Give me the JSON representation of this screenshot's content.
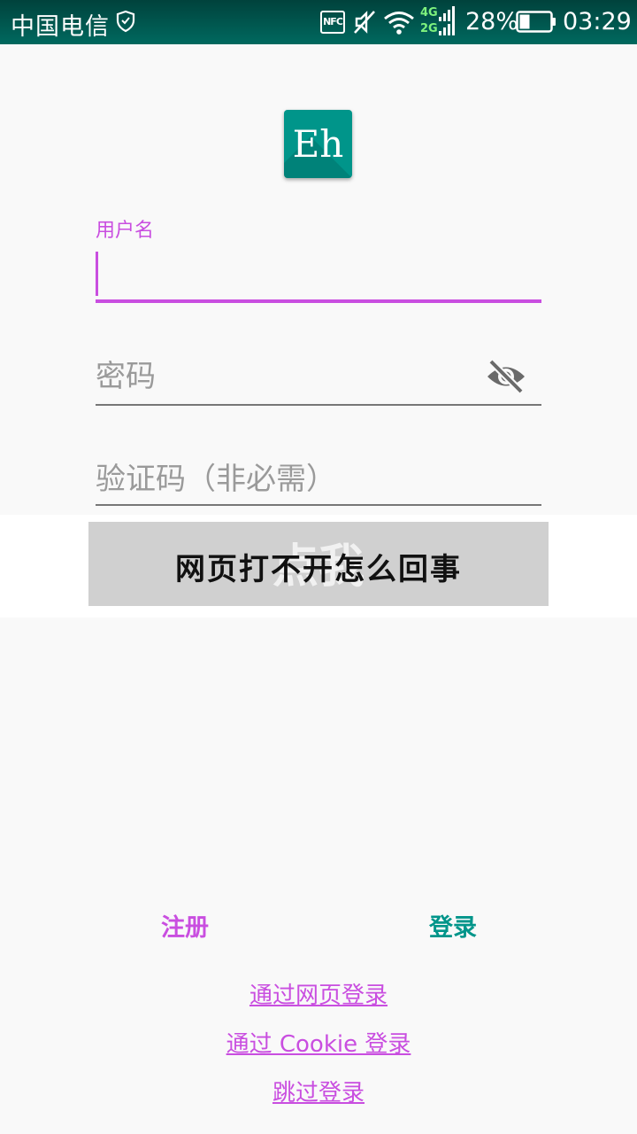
{
  "status_bar": {
    "carrier": "中国电信",
    "nfc_label": "NFC",
    "net_top": "4G",
    "net_bottom": "2G",
    "battery_percent": "28%",
    "time": "03:29"
  },
  "app": {
    "logo_text": "Eh",
    "accent_color": "#c94ee0",
    "teal_color": "#00958a"
  },
  "form": {
    "username": {
      "label": "用户名",
      "value": ""
    },
    "password": {
      "placeholder": "密码",
      "value": ""
    },
    "captcha": {
      "placeholder": "验证码（非必需）",
      "value": ""
    }
  },
  "overlay": {
    "ghost_text": "点我",
    "title": "网页打不开怎么回事"
  },
  "buttons": {
    "register": "注册",
    "login": "登录"
  },
  "links": {
    "web_login": "通过网页登录",
    "cookie_login": "通过 Cookie 登录",
    "skip_login": "跳过登录"
  }
}
